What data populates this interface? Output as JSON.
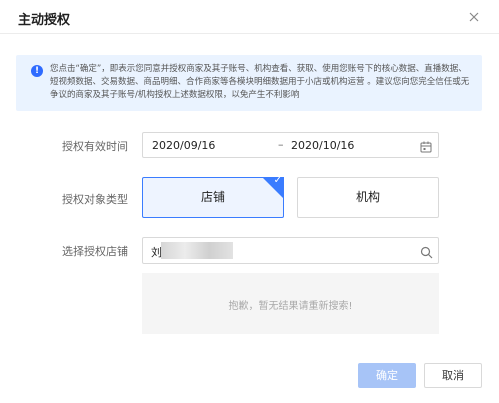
{
  "dialog": {
    "title": "主动授权",
    "close_icon": "close-icon"
  },
  "notice": {
    "icon": "info-icon",
    "icon_glyph": "!",
    "text": "您点击“确定”，即表示您同意并授权商家及其子账号、机构查看、获取、使用您账号下的核心数据、直播数据、短视频数据、交易数据、商品明细、合作商家等各模块明细数据用于小店或机构运营 。建议您向您完全信任或无争议的商家及其子账号/机构授权上述数据权限，以免产生不利影响"
  },
  "form": {
    "validity_label": "授权有效时间",
    "start_date": "2020/09/16",
    "date_separator": "–",
    "end_date": "2020/10/16",
    "calendar_icon": "calendar-icon",
    "type_label": "授权对象类型",
    "type_options": [
      "店铺",
      "机构"
    ],
    "selected_type": "店铺",
    "store_label": "选择授权店铺",
    "store_search_value": "刘",
    "search_icon": "search-icon",
    "empty_message": "抱歉，暂无结果请重新搜索!"
  },
  "footer": {
    "confirm_label": "确定",
    "cancel_label": "取消"
  },
  "colors": {
    "accent": "#3a7cff",
    "notice_bg": "#eaf3ff",
    "confirm_disabled": "#a7c4f7"
  }
}
